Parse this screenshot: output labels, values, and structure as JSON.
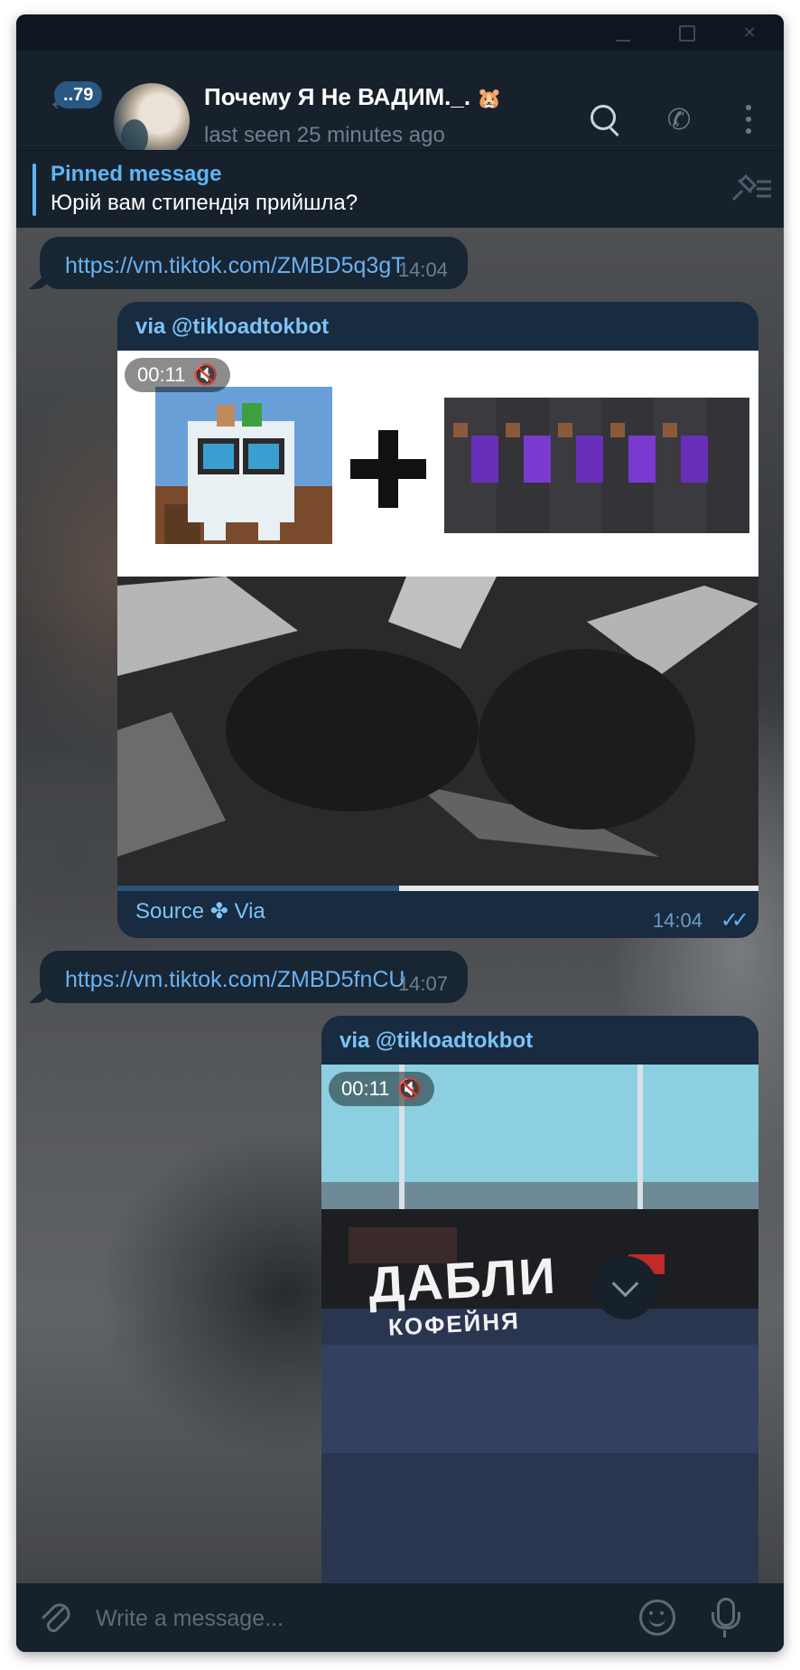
{
  "window": {
    "controls": [
      "minimize",
      "maximize",
      "close"
    ]
  },
  "header": {
    "unread_count": "..79",
    "title": "Почему Я Не ВАДИМ._.",
    "status": "last seen 25 minutes ago",
    "icons": [
      "back-arrow-icon",
      "search-icon",
      "phone-icon",
      "more-icon"
    ]
  },
  "pinned": {
    "title": "Pinned message",
    "text": "Юрій вам стипендія прийшла?"
  },
  "messages": [
    {
      "type": "incoming",
      "text": "https://vm.tiktok.com/ZMBD5q3gT",
      "time": "14:04"
    },
    {
      "type": "outgoing-video",
      "via": "via @tikloadtokbot",
      "duration": "00:11",
      "progress": 0.44,
      "footer": "Source ✤ Via",
      "time": "14:04",
      "read": true
    },
    {
      "type": "incoming",
      "text": "https://vm.tiktok.com/ZMBD5fnCU",
      "time": "14:07"
    },
    {
      "type": "outgoing-video",
      "via": "via @tikloadtokbot",
      "duration": "00:11",
      "sign_text": "ДАБЛИ",
      "sign_subtext": "КОФЕЙНЯ"
    }
  ],
  "composer": {
    "placeholder": "Write a message..."
  },
  "colors": {
    "accent": "#5eb5f7",
    "bg": "#0e1621",
    "panel": "#17212b",
    "bubble_in": "#182533",
    "bubble_out": "#182b40"
  }
}
